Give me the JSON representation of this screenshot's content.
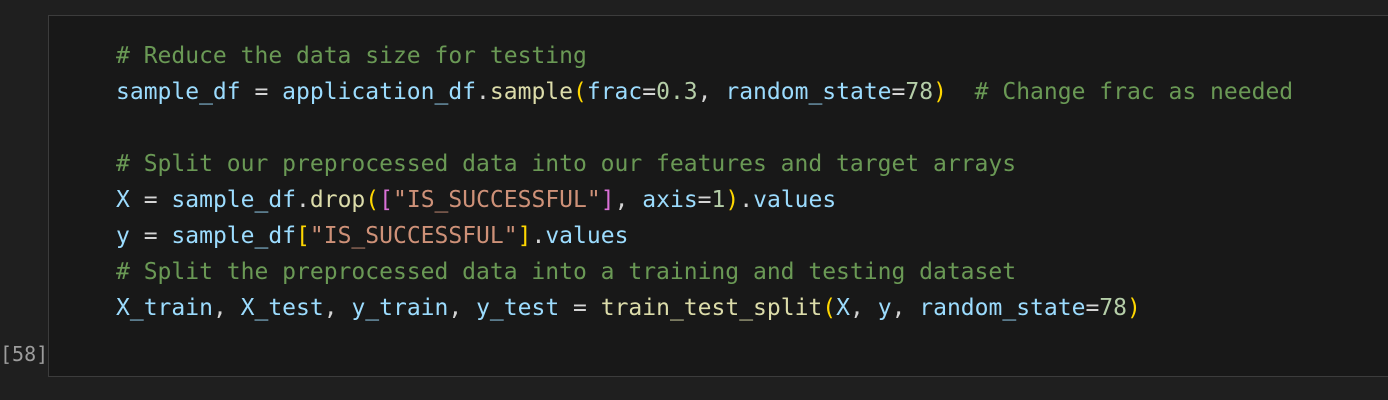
{
  "cell": {
    "execution_count": "[58]",
    "lines": [
      [
        {
          "t": "# Reduce the data size for testing",
          "c": "cm"
        }
      ],
      [
        {
          "t": "sample_df",
          "c": "vr"
        },
        {
          "t": " = ",
          "c": "op"
        },
        {
          "t": "application_df",
          "c": "vr"
        },
        {
          "t": ".",
          "c": "op"
        },
        {
          "t": "sample",
          "c": "fn"
        },
        {
          "t": "(",
          "c": "b1"
        },
        {
          "t": "frac",
          "c": "vr"
        },
        {
          "t": "=",
          "c": "op"
        },
        {
          "t": "0.3",
          "c": "nm"
        },
        {
          "t": ", ",
          "c": "op"
        },
        {
          "t": "random_state",
          "c": "vr"
        },
        {
          "t": "=",
          "c": "op"
        },
        {
          "t": "78",
          "c": "nm"
        },
        {
          "t": ")",
          "c": "b1"
        },
        {
          "t": "  # Change frac as needed",
          "c": "cm"
        }
      ],
      [],
      [
        {
          "t": "# Split our preprocessed data into our features and target arrays",
          "c": "cm"
        }
      ],
      [
        {
          "t": "X",
          "c": "vr"
        },
        {
          "t": " = ",
          "c": "op"
        },
        {
          "t": "sample_df",
          "c": "vr"
        },
        {
          "t": ".",
          "c": "op"
        },
        {
          "t": "drop",
          "c": "fn"
        },
        {
          "t": "(",
          "c": "b1"
        },
        {
          "t": "[",
          "c": "b2"
        },
        {
          "t": "\"IS_SUCCESSFUL\"",
          "c": "st"
        },
        {
          "t": "]",
          "c": "b2"
        },
        {
          "t": ", ",
          "c": "op"
        },
        {
          "t": "axis",
          "c": "vr"
        },
        {
          "t": "=",
          "c": "op"
        },
        {
          "t": "1",
          "c": "nm"
        },
        {
          "t": ")",
          "c": "b1"
        },
        {
          "t": ".",
          "c": "op"
        },
        {
          "t": "values",
          "c": "vr"
        }
      ],
      [
        {
          "t": "y",
          "c": "vr"
        },
        {
          "t": " = ",
          "c": "op"
        },
        {
          "t": "sample_df",
          "c": "vr"
        },
        {
          "t": "[",
          "c": "b1"
        },
        {
          "t": "\"IS_SUCCESSFUL\"",
          "c": "st"
        },
        {
          "t": "]",
          "c": "b1"
        },
        {
          "t": ".",
          "c": "op"
        },
        {
          "t": "values",
          "c": "vr"
        }
      ],
      [
        {
          "t": "# Split the preprocessed data into a training and testing dataset",
          "c": "cm"
        }
      ],
      [
        {
          "t": "X_train",
          "c": "vr"
        },
        {
          "t": ", ",
          "c": "op"
        },
        {
          "t": "X_test",
          "c": "vr"
        },
        {
          "t": ", ",
          "c": "op"
        },
        {
          "t": "y_train",
          "c": "vr"
        },
        {
          "t": ", ",
          "c": "op"
        },
        {
          "t": "y_test",
          "c": "vr"
        },
        {
          "t": " = ",
          "c": "op"
        },
        {
          "t": "train_test_split",
          "c": "fn"
        },
        {
          "t": "(",
          "c": "b1"
        },
        {
          "t": "X",
          "c": "vr"
        },
        {
          "t": ", ",
          "c": "op"
        },
        {
          "t": "y",
          "c": "vr"
        },
        {
          "t": ", ",
          "c": "op"
        },
        {
          "t": "random_state",
          "c": "vr"
        },
        {
          "t": "=",
          "c": "op"
        },
        {
          "t": "78",
          "c": "nm"
        },
        {
          "t": ")",
          "c": "b1"
        }
      ]
    ]
  }
}
